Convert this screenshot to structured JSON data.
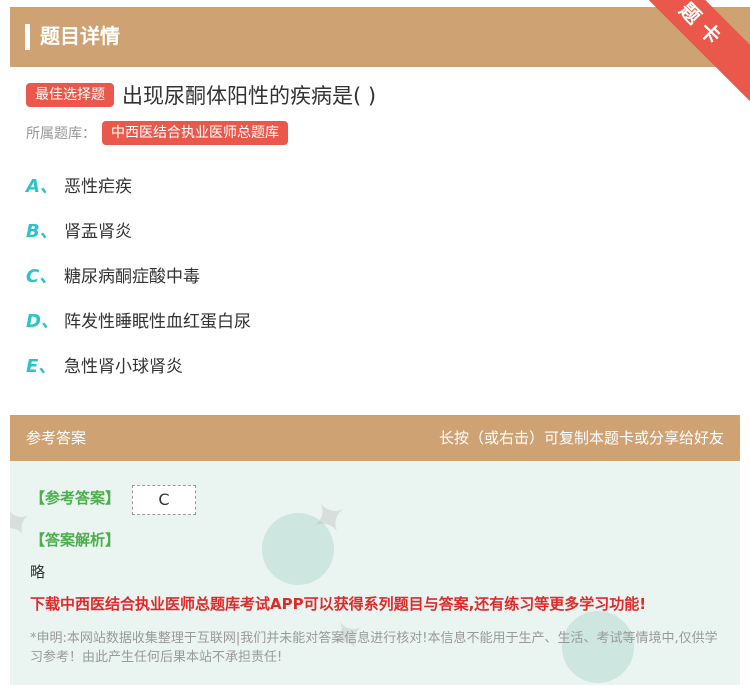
{
  "header": {
    "title": "题目详情"
  },
  "ribbon": {
    "label": "题卡"
  },
  "question": {
    "type_badge": "最佳选择题",
    "text": "出现尿酮体阳性的疾病是( )",
    "library_label": "所属题库：",
    "library_name": "中西医结合执业医师总题库"
  },
  "options": [
    {
      "letter": "A、",
      "text": "恶性疟疾"
    },
    {
      "letter": "B、",
      "text": "肾盂肾炎"
    },
    {
      "letter": "C、",
      "text": "糖尿病酮症酸中毒"
    },
    {
      "letter": "D、",
      "text": "阵发性睡眠性血红蛋白尿"
    },
    {
      "letter": "E、",
      "text": "急性肾小球肾炎"
    }
  ],
  "answer_section": {
    "title": "参考答案",
    "hint": "长按（或右击）可复制本题卡或分享给好友",
    "answer_label": "【参考答案】",
    "answer_value": "C",
    "analysis_label": "【答案解析】",
    "analysis_text": "略",
    "download_text": "下载中西医结合执业医师总题库考试APP可以获得系列题目与答案,还有练习等更多学习功能!",
    "disclaimer": "*申明:本网站数据收集整理于互联网|我们并未能对答案信息进行核对!本信息不能用于生产、生活、考试等情境中,仅供学习参考！由此产生任何后果本站不承担责任!"
  },
  "colors": {
    "accent": "#cfa274",
    "badge": "#e9584a",
    "option_letter": "#2cc3c9",
    "answer_green": "#4cae4c",
    "download_red": "#e02a2a"
  }
}
